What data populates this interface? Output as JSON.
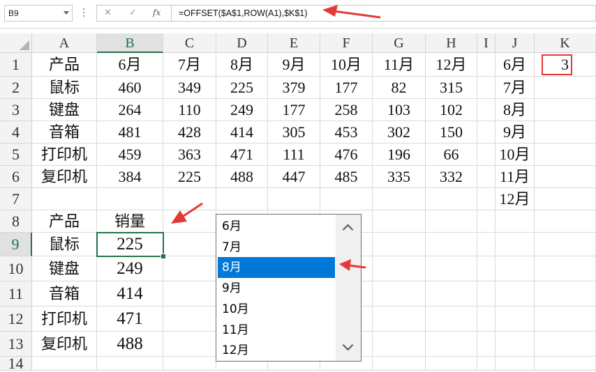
{
  "name_box": "B9",
  "formula_bar": {
    "cancel_icon": "✕",
    "enter_icon": "✓",
    "fx_label": "fx",
    "formula": "=OFFSET($A$1,ROW(A1),$K$1)"
  },
  "columns": [
    "A",
    "B",
    "C",
    "D",
    "E",
    "F",
    "G",
    "H",
    "I",
    "J",
    "K"
  ],
  "rows": [
    "1",
    "2",
    "3",
    "4",
    "5",
    "6",
    "7",
    "8",
    "9",
    "10",
    "11",
    "12",
    "13",
    "14"
  ],
  "active_cell": "B9",
  "sheet": {
    "row1": [
      "产品",
      "6月",
      "7月",
      "8月",
      "9月",
      "10月",
      "11月",
      "12月",
      "",
      "6月",
      "3"
    ],
    "row2": [
      "鼠标",
      "460",
      "349",
      "225",
      "379",
      "177",
      "82",
      "315",
      "",
      "7月",
      ""
    ],
    "row3": [
      "键盘",
      "264",
      "110",
      "249",
      "177",
      "258",
      "103",
      "102",
      "",
      "8月",
      ""
    ],
    "row4": [
      "音箱",
      "481",
      "428",
      "414",
      "305",
      "453",
      "302",
      "150",
      "",
      "9月",
      ""
    ],
    "row5": [
      "打印机",
      "459",
      "363",
      "471",
      "111",
      "476",
      "196",
      "66",
      "",
      "10月",
      ""
    ],
    "row6": [
      "复印机",
      "384",
      "225",
      "488",
      "447",
      "485",
      "335",
      "332",
      "",
      "11月",
      ""
    ],
    "row7": [
      "",
      "",
      "",
      "",
      "",
      "",
      "",
      "",
      "",
      "12月",
      ""
    ],
    "row8": [
      "产品",
      "销量"
    ],
    "row9": [
      "鼠标",
      "225"
    ],
    "row10": [
      "键盘",
      "249"
    ],
    "row11": [
      "音箱",
      "414"
    ],
    "row12": [
      "打印机",
      "471"
    ],
    "row13": [
      "复印机",
      "488"
    ]
  },
  "listbox": {
    "items": [
      "6月",
      "7月",
      "8月",
      "9月",
      "10月",
      "11月",
      "12月"
    ],
    "selected": "8月"
  },
  "colors": {
    "accent_green": "#217346",
    "selection_blue": "#0078d7",
    "annotation_red": "#e53935"
  }
}
